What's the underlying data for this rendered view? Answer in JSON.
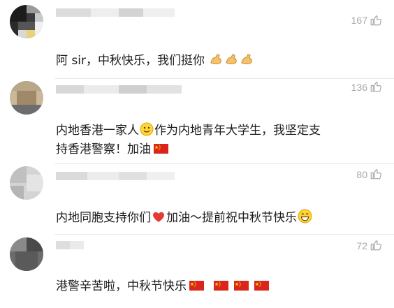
{
  "comments": [
    {
      "likes": "167",
      "text": "阿 sir，中秋快乐，我们挺你",
      "emojis": [
        "flexed-biceps-icon",
        "flexed-biceps-icon",
        "flexed-biceps-icon"
      ]
    },
    {
      "likes": "136",
      "text_line1": "内地香港一家人",
      "text_line1b": "作为内地青年大学生，我坚定支",
      "text_line2": "持香港警察！加油",
      "emojis": [
        "slightly-smiling-face-icon",
        "china-flag-icon"
      ]
    },
    {
      "likes": "80",
      "text_a": "内地同胞支持你们",
      "text_b": "加油～提前祝中秋节快乐",
      "emojis": [
        "red-heart-icon",
        "grinning-face-icon"
      ]
    },
    {
      "likes": "72",
      "text": "港警辛苦啦，中秋节快乐",
      "emojis": [
        "china-flag-icon",
        "china-flag-icon",
        "china-flag-icon",
        "china-flag-icon"
      ]
    }
  ],
  "colors": {
    "text": "#1d1d1d",
    "likes": "#a8a8a8",
    "flag_red": "#d9251c",
    "flag_star": "#ffde00"
  }
}
